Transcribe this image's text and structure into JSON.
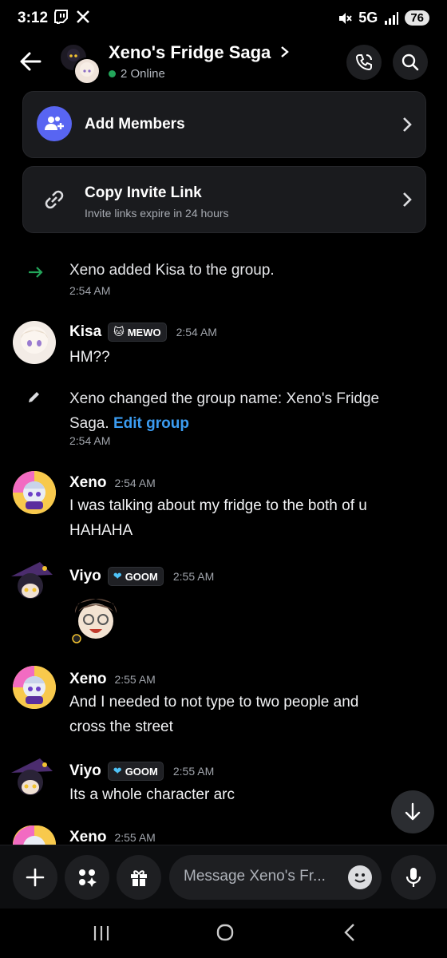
{
  "status_bar": {
    "time": "3:12",
    "network": "5G",
    "battery": "76"
  },
  "header": {
    "title": "Xeno's Fridge Saga",
    "online": "2 Online"
  },
  "cards": {
    "add_members": {
      "label": "Add Members"
    },
    "invite": {
      "label": "Copy Invite Link",
      "sub": "Invite links expire in 24 hours"
    }
  },
  "messages": {
    "sys1": {
      "text": "Xeno added Kisa to the group.",
      "time": "2:54 AM"
    },
    "kisa": {
      "name": "Kisa",
      "tag": "MEWO",
      "time": "2:54 AM",
      "text": "HM??"
    },
    "sys2": {
      "text_line1": "Xeno changed the group name: Xeno's Fridge",
      "text_line2": "Saga.",
      "link": "Edit group",
      "time": "2:54 AM"
    },
    "xeno1": {
      "name": "Xeno",
      "time": "2:54 AM",
      "line1": "I was talking about my fridge to the both of u",
      "line2": "HAHAHA"
    },
    "viyo1": {
      "name": "Viyo",
      "tag": "GOOM",
      "time": "2:55 AM"
    },
    "xeno2": {
      "name": "Xeno",
      "time": "2:55 AM",
      "line1": "And I needed to not type to two people and",
      "line2": "cross the street"
    },
    "viyo2": {
      "name": "Viyo",
      "tag": "GOOM",
      "time": "2:55 AM",
      "text": "Its a whole character arc"
    },
    "xeno3": {
      "name": "Xeno",
      "time": "2:55 AM"
    }
  },
  "composer": {
    "placeholder": "Message Xeno's Fr..."
  },
  "colors": {
    "blurple": "#5865f2",
    "online": "#23a55a",
    "link": "#3b9cf1"
  }
}
